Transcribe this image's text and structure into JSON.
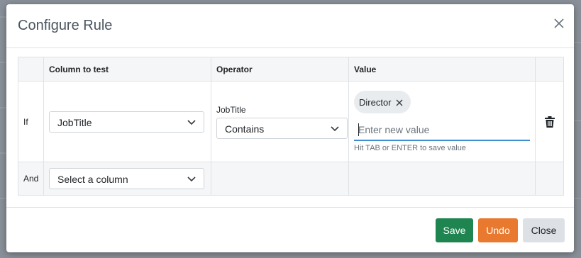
{
  "dialog": {
    "title": "Configure Rule"
  },
  "table": {
    "headers": [
      "",
      "Column to test",
      "Operator",
      "Value",
      ""
    ],
    "rows": [
      {
        "label": "If",
        "column_value": "JobTitle",
        "operator_caption": "JobTitle",
        "operator_value": "Contains",
        "value_chips": [
          "Director"
        ],
        "value_placeholder": "Enter new value",
        "value_hint": "Hit TAB or ENTER to save value"
      },
      {
        "label": "And",
        "column_placeholder": "Select a column"
      }
    ]
  },
  "footer": {
    "save_label": "Save",
    "undo_label": "Undo",
    "close_label": "Close"
  },
  "colors": {
    "save": "#1e8551",
    "undo": "#e8792f",
    "close": "#dde1e6",
    "focus": "#3e8ed0"
  },
  "icons": {
    "dialog_close": "close-icon",
    "chip_remove": "close-icon",
    "dropdown": "chevron-down-icon",
    "delete_row": "trash-icon"
  }
}
